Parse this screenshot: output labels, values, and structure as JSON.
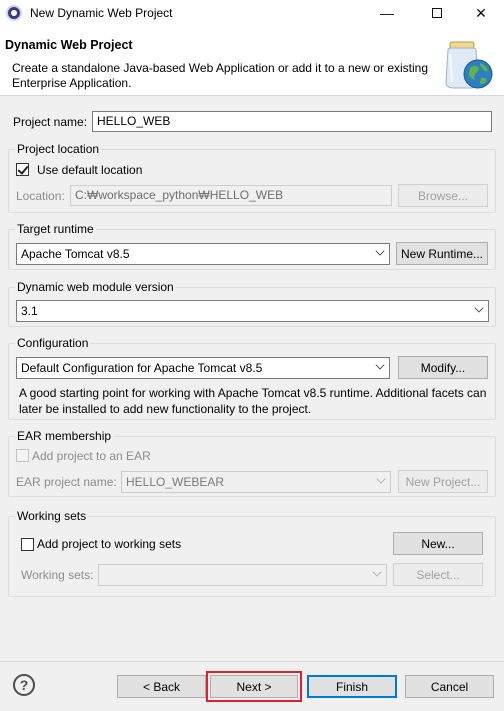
{
  "window": {
    "title": "New Dynamic Web Project",
    "minimize_glyph": "—",
    "close_glyph": "✕"
  },
  "header": {
    "title": "Dynamic Web Project",
    "description": "Create a standalone Java-based Web Application or add it to a new or existing Enterprise Application."
  },
  "project_name": {
    "label": "Project name:",
    "value": "HELLO_WEB"
  },
  "project_location": {
    "group_title": "Project location",
    "use_default_label": "Use default location",
    "use_default_checked": true,
    "location_label": "Location:",
    "location_value": "C:₩workspace_python₩HELLO_WEB",
    "browse_label": "Browse..."
  },
  "target_runtime": {
    "group_title": "Target runtime",
    "selected": "Apache Tomcat v8.5",
    "new_runtime_label": "New Runtime..."
  },
  "module_version": {
    "group_title": "Dynamic web module version",
    "selected": "3.1"
  },
  "configuration": {
    "group_title": "Configuration",
    "selected": "Default Configuration for Apache Tomcat v8.5",
    "modify_label": "Modify...",
    "description": "A good starting point for working with Apache Tomcat v8.5 runtime. Additional facets can later be installed to add new functionality to the project."
  },
  "ear_membership": {
    "group_title": "EAR membership",
    "add_to_ear_label": "Add project to an EAR",
    "add_to_ear_checked": false,
    "ear_project_label": "EAR project name:",
    "ear_project_value": "HELLO_WEBEAR",
    "new_project_label": "New Project..."
  },
  "working_sets": {
    "group_title": "Working sets",
    "add_label": "Add project to working sets",
    "add_checked": false,
    "new_label": "New...",
    "working_sets_label": "Working sets:",
    "working_sets_value": "",
    "select_label": "Select..."
  },
  "footer": {
    "help_glyph": "?",
    "back_label": "< Back",
    "next_label": "Next >",
    "finish_label": "Finish",
    "cancel_label": "Cancel"
  },
  "colors": {
    "default_button_border": "#0078d7",
    "highlight_frame": "#e0202a"
  }
}
